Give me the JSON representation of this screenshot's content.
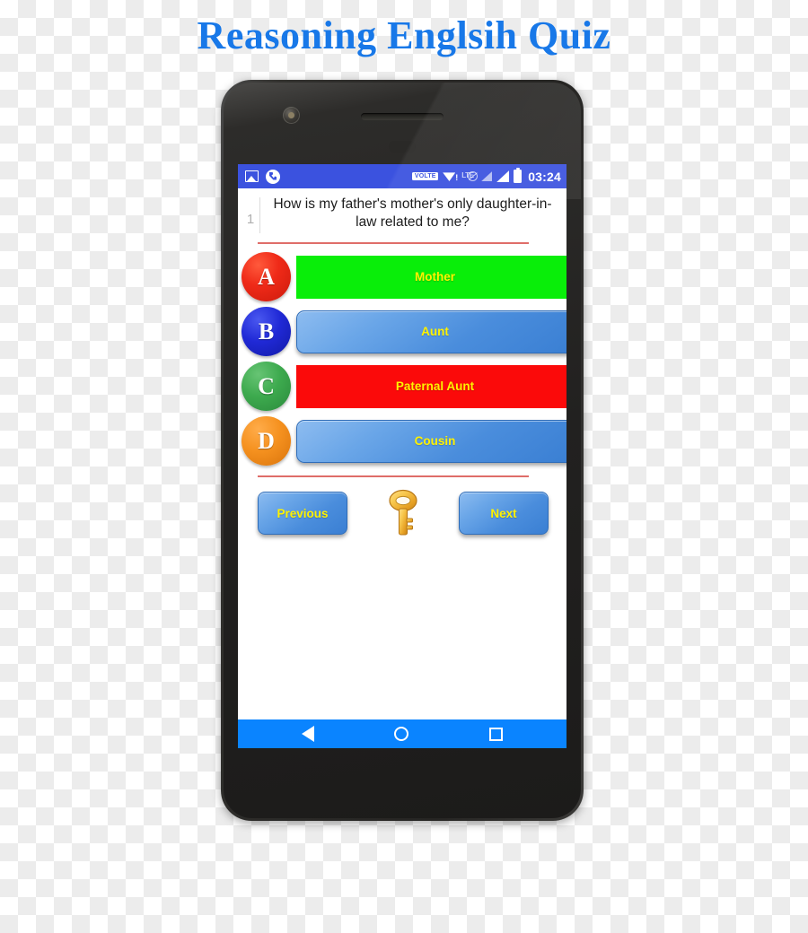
{
  "page": {
    "title": "Reasoning Englsih Quiz",
    "title_color": "#1878E8"
  },
  "device": {
    "name": "android-phone-mockup",
    "front_camera": "front-camera",
    "earpiece": "earpiece-speaker"
  },
  "statusbar": {
    "background": "#3B52DF",
    "left_icons": [
      "image-icon",
      "phone-icon"
    ],
    "volte_label": "VOLTE",
    "wifi_alert": "!",
    "lte_label": "LTE",
    "time": "03:24"
  },
  "quiz": {
    "question_number": "1",
    "question_text": "How is my father's mother's only daughter-in-law related to me?",
    "divider_color": "#D9534F",
    "options": [
      {
        "letter": "A",
        "label": "Mother",
        "badge_color": "#EF2A18",
        "button_style": "green",
        "button_color": "#09EE09"
      },
      {
        "letter": "B",
        "label": "Aunt",
        "badge_color": "#2029D6",
        "button_style": "blue",
        "button_color": "#4A8DDC"
      },
      {
        "letter": "C",
        "label": "Paternal Aunt",
        "badge_color": "#3DAA4E",
        "button_style": "red",
        "button_color": "#FB0A0A"
      },
      {
        "letter": "D",
        "label": "Cousin",
        "badge_color": "#F5911F",
        "button_style": "blue",
        "button_color": "#4A8DDC"
      }
    ],
    "option_text_color": "#FFF200",
    "nav": {
      "previous_label": "Previous",
      "next_label": "Next",
      "key_icon": "key-icon"
    }
  },
  "androidnav": {
    "background": "#0A84FF",
    "buttons": [
      "back-icon",
      "home-icon",
      "recents-icon"
    ]
  }
}
